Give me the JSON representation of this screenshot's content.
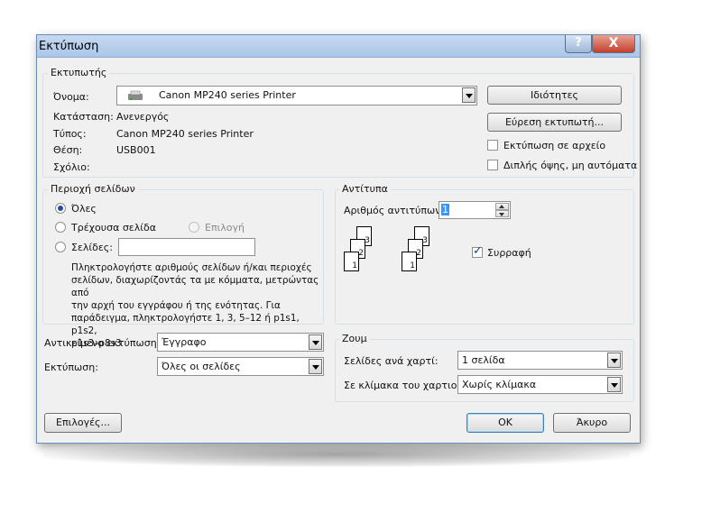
{
  "window": {
    "title": "Εκτύπωση",
    "help_glyph": "?",
    "close_glyph": "X"
  },
  "printer": {
    "legend": "Εκτυπωτής",
    "name_label": "Όνομα:",
    "name_value": "Canon MP240 series Printer",
    "status_label": "Κατάσταση:",
    "status_value": "Ανενεργός",
    "type_label": "Τύπος:",
    "type_value": "Canon MP240 series Printer",
    "where_label": "Θέση:",
    "where_value": "USB001",
    "comment_label": "Σχόλιο:",
    "properties_button": "Ιδιότητες",
    "find_printer_button": "Εύρεση εκτυπωτή...",
    "print_to_file": "Εκτύπωση σε αρχείο",
    "manual_duplex": "Διπλής όψης, μη αυτόματα"
  },
  "page_range": {
    "legend": "Περιοχή σελίδων",
    "all": "Όλες",
    "current_page": "Τρέχουσα σελίδα",
    "selection": "Επιλογή",
    "pages": "Σελίδες:",
    "help_text_lines": [
      "Πληκτρολογήστε αριθμούς σελίδων ή/και περιοχές",
      "σελίδων, διαχωρίζοντάς τα με κόμματα, μετρώντας από",
      "την αρχή του εγγράφου ή της ενότητας. Για",
      "παράδειγμα, πληκτρολογήστε 1, 3, 5–12 ή p1s1, p1s2,",
      "p1s3–p8s3"
    ]
  },
  "copies": {
    "legend": "Αντίτυπα",
    "number_label": "Αριθμός αντιτύπων:",
    "number_value": "1",
    "collate": "Συρραφή",
    "page_numbers": [
      "3",
      "2",
      "1"
    ]
  },
  "print_what": {
    "label": "Αντικείμενο εκτύπωσης:",
    "value": "Έγγραφο"
  },
  "print": {
    "label": "Εκτύπωση:",
    "value": "Όλες οι σελίδες"
  },
  "zoom": {
    "legend": "Ζουμ",
    "pages_per_sheet_label": "Σελίδες ανά χαρτί:",
    "pages_per_sheet_value": "1 σελίδα",
    "scale_label": "Σε κλίμακα του χαρτιού:",
    "scale_value": "Χωρίς κλίμακα"
  },
  "buttons": {
    "options": "Επιλογές...",
    "ok": "OK",
    "cancel": "Άκυρο"
  }
}
